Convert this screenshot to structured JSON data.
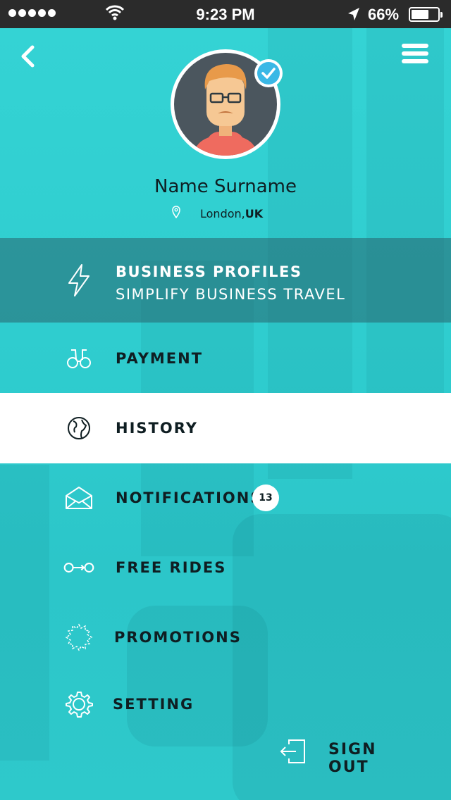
{
  "status_bar": {
    "time": "9:23 PM",
    "battery_percent": "66%",
    "battery_level": 0.66
  },
  "profile": {
    "name": "Name Surname",
    "city": "London, ",
    "country": "UK"
  },
  "menu": {
    "business": {
      "line1": "BUSINESS PROFILES",
      "line2": "SIMPLIFY BUSINESS TRAVEL",
      "icon": "lightning-icon"
    },
    "payment": {
      "label": "PAYMENT",
      "icon": "binoculars-icon"
    },
    "history": {
      "label": "HISTORY",
      "icon": "globe-icon"
    },
    "notifications": {
      "label": "NOTIFICATIONS",
      "icon": "envelope-icon",
      "badge": "13"
    },
    "free_rides": {
      "label": "FREE RIDES",
      "icon": "link-icon"
    },
    "promotions": {
      "label": "PROMOTIONS",
      "icon": "starburst-icon"
    },
    "setting": {
      "label": "SETTING",
      "icon": "gear-icon"
    }
  },
  "sign_out": {
    "label": "SIGN OUT",
    "icon": "sign-out-icon"
  },
  "colors": {
    "background": "#32d4d4",
    "status_bar": "#2b2b2b",
    "business_overlay": "#28646e",
    "history_highlight": "#ffffff",
    "verified": "#3ab8e6",
    "text": "#0f1e22"
  }
}
